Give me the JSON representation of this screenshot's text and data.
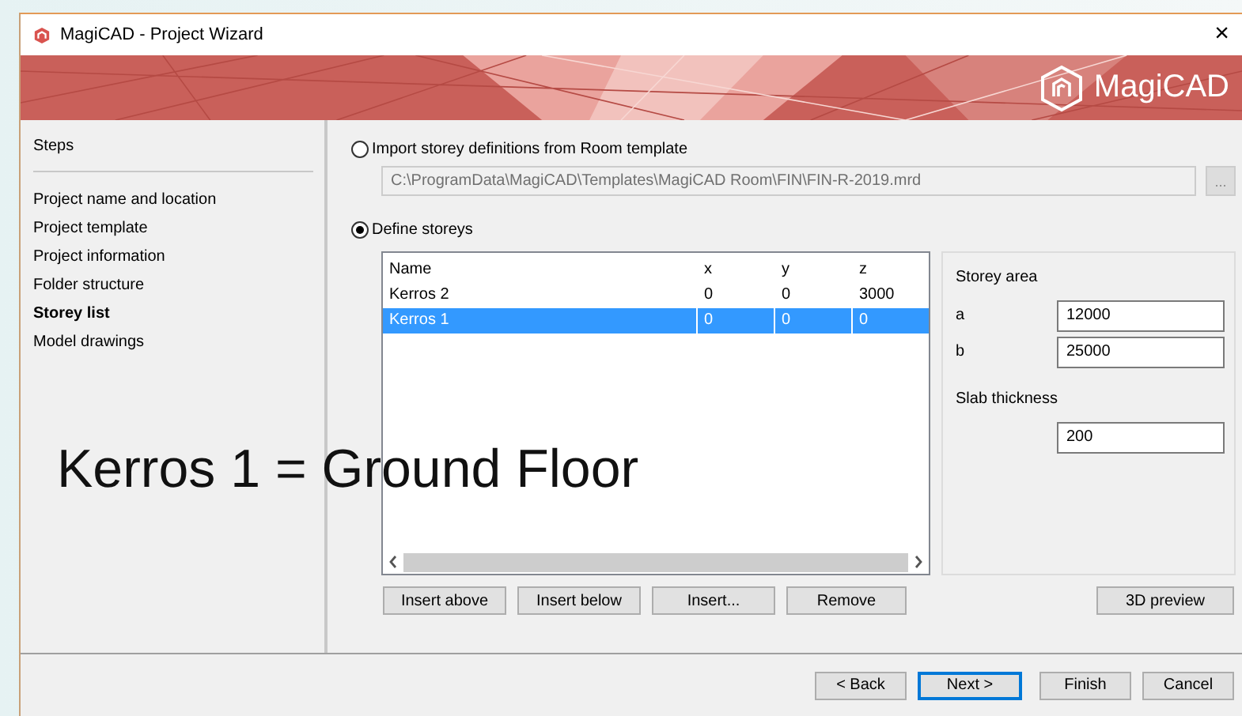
{
  "window": {
    "title": "MagiCAD - Project Wizard",
    "close": "×"
  },
  "banner": {
    "logo": "MagiCAD"
  },
  "steps": {
    "heading": "Steps",
    "items": [
      {
        "label": "Project name and location",
        "selected": false
      },
      {
        "label": "Project template",
        "selected": false
      },
      {
        "label": "Project information",
        "selected": false
      },
      {
        "label": "Folder structure",
        "selected": false
      },
      {
        "label": "Storey list",
        "selected": true
      },
      {
        "label": "Model drawings",
        "selected": false
      }
    ]
  },
  "import_option": {
    "label": "Import storey definitions from Room template",
    "selected": false,
    "disabled": true,
    "path": "C:\\ProgramData\\MagiCAD\\Templates\\MagiCAD Room\\FIN\\FIN-R-2019.mrd",
    "browse": "..."
  },
  "define_option": {
    "label": "Define storeys",
    "selected": true
  },
  "storeys": {
    "columns": [
      "Name",
      "x",
      "y",
      "z"
    ],
    "rows": [
      {
        "cells": [
          "Kerros 2",
          "0",
          "0",
          "3000"
        ],
        "selected": false
      },
      {
        "cells": [
          "Kerros 1",
          "0",
          "0",
          "0"
        ],
        "selected": true
      }
    ]
  },
  "storey_area": {
    "title": "Storey area",
    "fields": [
      {
        "label": "a",
        "value": "12000"
      },
      {
        "label": "b",
        "value": "25000"
      }
    ]
  },
  "slab": {
    "title": "Slab thickness",
    "value": "200"
  },
  "table_buttons": [
    "Insert above",
    "Insert below",
    "Insert...",
    "Remove"
  ],
  "preview_button": "3D preview",
  "nav_buttons": [
    {
      "label": "< Back",
      "default": false
    },
    {
      "label": "Next >",
      "default": true
    },
    {
      "label": "Finish",
      "default": false
    },
    {
      "label": "Cancel",
      "default": false
    }
  ],
  "annotation": "Kerros 1 = Ground Floor"
}
